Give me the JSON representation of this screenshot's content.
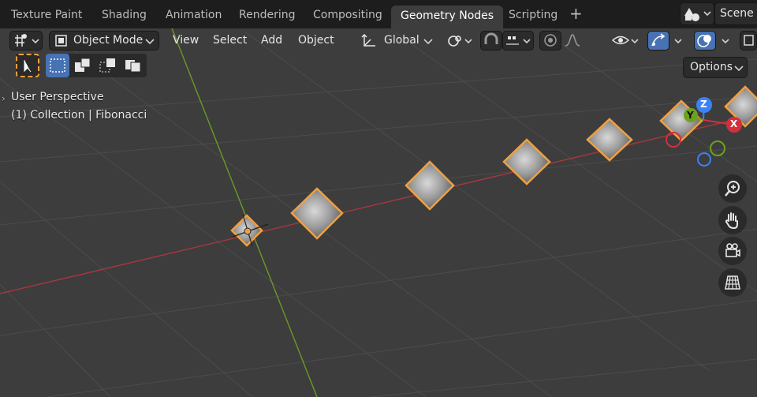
{
  "workspace_tabs": [
    {
      "label": "Texture Paint",
      "active": false
    },
    {
      "label": "Shading",
      "active": false
    },
    {
      "label": "Animation",
      "active": false
    },
    {
      "label": "Rendering",
      "active": false
    },
    {
      "label": "Compositing",
      "active": false
    },
    {
      "label": "Geometry Nodes",
      "active": true
    },
    {
      "label": "Scripting",
      "active": false
    }
  ],
  "add_workspace": "+",
  "scene": {
    "label": "Scene"
  },
  "header": {
    "mode": "Object Mode",
    "menus": [
      "View",
      "Select",
      "Add",
      "Object"
    ],
    "transform_orientation": "Global"
  },
  "overlay": {
    "view_name": "User Perspective",
    "collection_info": "(1) Collection | Fibonacci"
  },
  "options_button": "Options",
  "gizmo": {
    "z_label": "Z",
    "y_label": "Y",
    "x_label": "X"
  },
  "colors": {
    "active_tab_bg": "#3d3d3d",
    "selection_outline": "#f0a040",
    "x_axis": "#d2303f",
    "y_axis": "#6ea020",
    "z_axis": "#3b82f6",
    "toggle_active": "#4772b3"
  },
  "icons": [
    "editor-type-icon",
    "object-mode-icon",
    "transform-orientation-icon",
    "pivot-icon",
    "snap-icon",
    "snap-increment-icon",
    "proportional-edit-icon",
    "falloff-icon",
    "visibility-icon",
    "gizmo-icon",
    "overlay-icon",
    "xray-icon",
    "zoom-icon",
    "hand-icon",
    "camera-icon",
    "grid-ortho-icon"
  ]
}
